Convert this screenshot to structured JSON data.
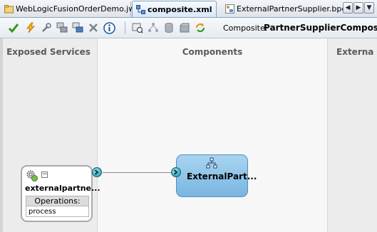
{
  "tabs": [
    {
      "label": "WebLogicFusionOrderDemo.jws",
      "icon": "workspace-icon",
      "active": false
    },
    {
      "label": "composite.xml",
      "icon": "composite-icon",
      "active": true
    },
    {
      "label": "ExternalPartnerSupplier.bpel",
      "icon": "bpel-icon",
      "active": false
    }
  ],
  "tab_nav": {
    "prev": "◀",
    "next": "▶",
    "list": "▼"
  },
  "toolbar": {
    "icons": [
      "validate-check-icon",
      "deploy-lightning-icon",
      "test-wrench-icon",
      "add-component-icon",
      "add-reference-icon",
      "delete-icon",
      "info-icon",
      "source-view-icon",
      "layout-icon",
      "database-icon",
      "package-icon",
      "refresh-icon"
    ],
    "composite_label": "Composite:",
    "composite_name": "PartnerSupplierComposite"
  },
  "lanes": {
    "exposed_services": "Exposed Services",
    "components": "Components",
    "external_references": "Externa"
  },
  "service": {
    "name": "externalpartne...",
    "collapse": "−",
    "operations_header": "Operations:",
    "operations": [
      "process"
    ]
  },
  "component": {
    "name": "ExternalPart..."
  },
  "colors": {
    "component_fill": "#8fc4ea",
    "wire_endpoint": "#1f8ea3",
    "active_tab": "#d8e7f7"
  }
}
